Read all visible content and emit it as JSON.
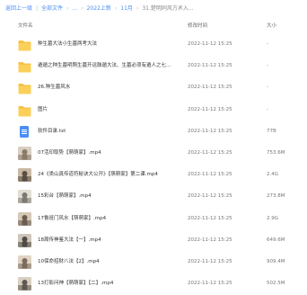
{
  "breadcrumb": {
    "back": "返回上一级",
    "items": [
      "全部文件",
      "...",
      "2022上新",
      "11月"
    ],
    "current": "31.楚明同风方术入..."
  },
  "header": {
    "name": "文件名",
    "time": "修改时间",
    "size": "大小"
  },
  "files": [
    {
      "type": "folder",
      "name": "种生墓大法小生墓两考大法",
      "time": "2022-11-12 15:25",
      "size": "-"
    },
    {
      "type": "folder",
      "name": "遁遁之种生墓明照生墓开运鼓遁大法、生墓必须有遁人之七...",
      "time": "2022-11-12 15:25",
      "size": "-"
    },
    {
      "type": "folder",
      "name": "26.种生墓风水",
      "time": "2022-11-12 15:25",
      "size": "-"
    },
    {
      "type": "folder",
      "name": "图片",
      "time": "2022-11-12 15:25",
      "size": "-"
    },
    {
      "type": "txt",
      "name": "软件目录.txt",
      "time": "2022-11-12 15:25",
      "size": "77B"
    },
    {
      "type": "video",
      "name": "07活印取势【萌萌家】.mp4",
      "time": "2022-11-12 15:25",
      "size": "753.6M"
    },
    {
      "type": "video",
      "name": "24《类山真传道符秘诀大公开》【萌萌家】第二课.mp4",
      "time": "2022-11-12 15:25",
      "size": "2.4G"
    },
    {
      "type": "video",
      "name": "15彩台【萌萌家】.mp4",
      "time": "2022-11-12 15:25",
      "size": "273.8M"
    },
    {
      "type": "video",
      "name": "17鲁班门风水【萌萌家】.mp4",
      "time": "2022-11-12 15:25",
      "size": "2.9G"
    },
    {
      "type": "video",
      "name": "18周传神鉴大法【一】.mp4",
      "time": "2022-11-12 15:25",
      "size": "649.6M"
    },
    {
      "type": "video",
      "name": "10保命招财八法【2】.mp4",
      "time": "2022-11-12 15:25",
      "size": "909.4M"
    },
    {
      "type": "video",
      "name": "13打影问神【萌萌家】【二】.mp4",
      "time": "2022-11-12 15:25",
      "size": "502.5M"
    }
  ],
  "colors": {
    "link": "#4b8ef5",
    "folder": "#f7c242",
    "txt": "#4b8ef5"
  }
}
